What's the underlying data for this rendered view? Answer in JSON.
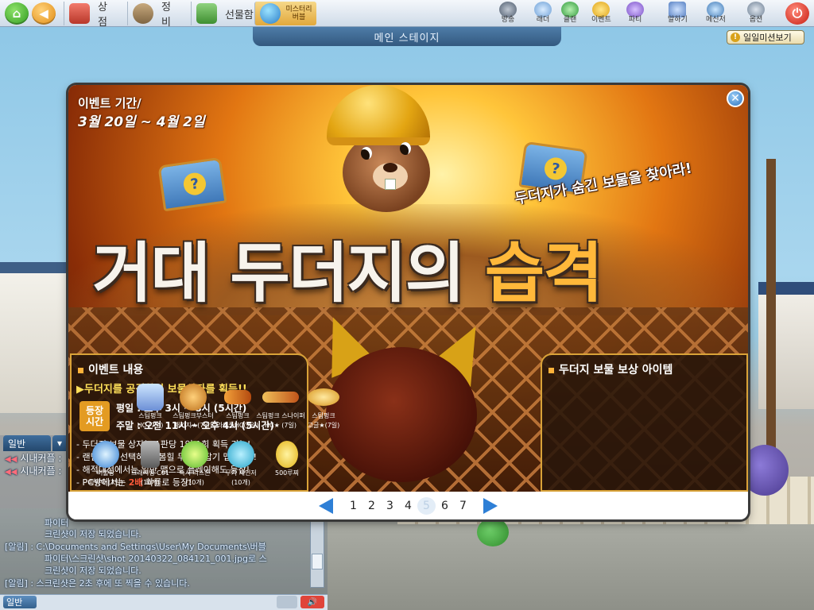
{
  "topbar": {
    "menu": [
      {
        "label": "상 점",
        "icon": "shop-icon"
      },
      {
        "label": "정 비",
        "icon": "backpack-icon"
      },
      {
        "label": "선물함",
        "icon": "gift-icon"
      },
      {
        "label": "미스터리 버블",
        "icon": "bubble-icon"
      }
    ],
    "right_icons": [
      {
        "label": "방송",
        "icon": "broadcast-icon"
      },
      {
        "label": "래더",
        "icon": "ladder-icon"
      },
      {
        "label": "클랜",
        "icon": "clan-icon"
      },
      {
        "label": "이벤트",
        "icon": "event-star-icon"
      },
      {
        "label": "파티",
        "icon": "party-icon"
      },
      {
        "label": "말하기",
        "icon": "chat-icon"
      },
      {
        "label": "메신저",
        "icon": "messenger-icon"
      },
      {
        "label": "옵션",
        "icon": "gear-icon"
      }
    ],
    "stage_title": "메인 스테이지",
    "daily_mission": "일일미션보기",
    "daily_mission_badge": "!"
  },
  "chat": {
    "tab_general": "일반",
    "lines": [
      {
        "speaker": "◀◀",
        "text": "시내커플 :"
      },
      {
        "speaker": "◀◀",
        "text": "시내커플 :"
      }
    ],
    "system_lines": [
      "파이터",
      "크린샷이 저장 되었습니다.",
      "[알림] : C:\\Documents and Settings\\User\\My Documents\\버블",
      "파이터\\스크린샷\\shot 20140322_084121_001.jpg로 스",
      "크린샷이 저장 되었습니다.",
      "[알림] : 스크린샷은 2초 후에 또 찍을 수 있습니다."
    ],
    "mode": "일반"
  },
  "popup": {
    "event_period_label": "이벤트 기간/",
    "event_period_dates": "3월 20일 ~ 4월 2일",
    "subtitle": "두더지가 숨긴 보물을 찾아라!",
    "title_part1": "거대 두더지의 ",
    "title_part2": "습격",
    "close_symbol": "✕",
    "chest_symbol": "?",
    "left_panel": {
      "header": "이벤트 내용",
      "headline": "▶두더지를 공격하여 보물상자를 획득!!",
      "time_box": [
        "등장",
        "시간"
      ],
      "weekday": "평일 : 오후 3시 ~ 8시 (5시간)",
      "weekend": "주말 : 오전 11시 ~ 오후 4시 (5시간)",
      "notes": [
        "- 두더지 보물 상자는 1판당 1인 1회 획득 가능!",
        "- 랜덤 맵을 선택하면 [봄힐 두더지 잡기 맵] 등장!",
        "- 해적대전에서는 일반 맵으로 플레이해도 등장!"
      ],
      "note_pc_prefix": "- PC방에서는 ",
      "note_pc_highlight": "2배",
      "note_pc_suffix": " 확률로 등장!"
    },
    "right_panel": {
      "header": "두더지 보물 보상 아이템",
      "rewards": [
        {
          "line1": "스팀펑크",
          "line2": "HC (7일)"
        },
        {
          "line1": "스팀펑크부스터",
          "line2": "패키지★(7일)"
        },
        {
          "line1": "스팀펑크",
          "line2": "라이플HC(7일)"
        },
        {
          "line1": "스팀펑크 스나이퍼",
          "line2": "HC★ (7일)"
        },
        {
          "line1": "스팀펑크",
          "line2": "고글★(7일)"
        },
        {
          "line1": "버블팡",
          "line2": "파워팩 (7일)"
        },
        {
          "line1": "크래시뱅 C01",
          "line2": "(10개)"
        },
        {
          "line1": "즉시 리스폰",
          "line2": "(10개)"
        },
        {
          "line1": "무기 체인저",
          "line2": "(10개)"
        },
        {
          "line1": "500루찌",
          "line2": ""
        }
      ]
    },
    "pager": {
      "pages": [
        "1",
        "2",
        "3",
        "4",
        "5",
        "6",
        "7"
      ],
      "current": "5"
    }
  }
}
